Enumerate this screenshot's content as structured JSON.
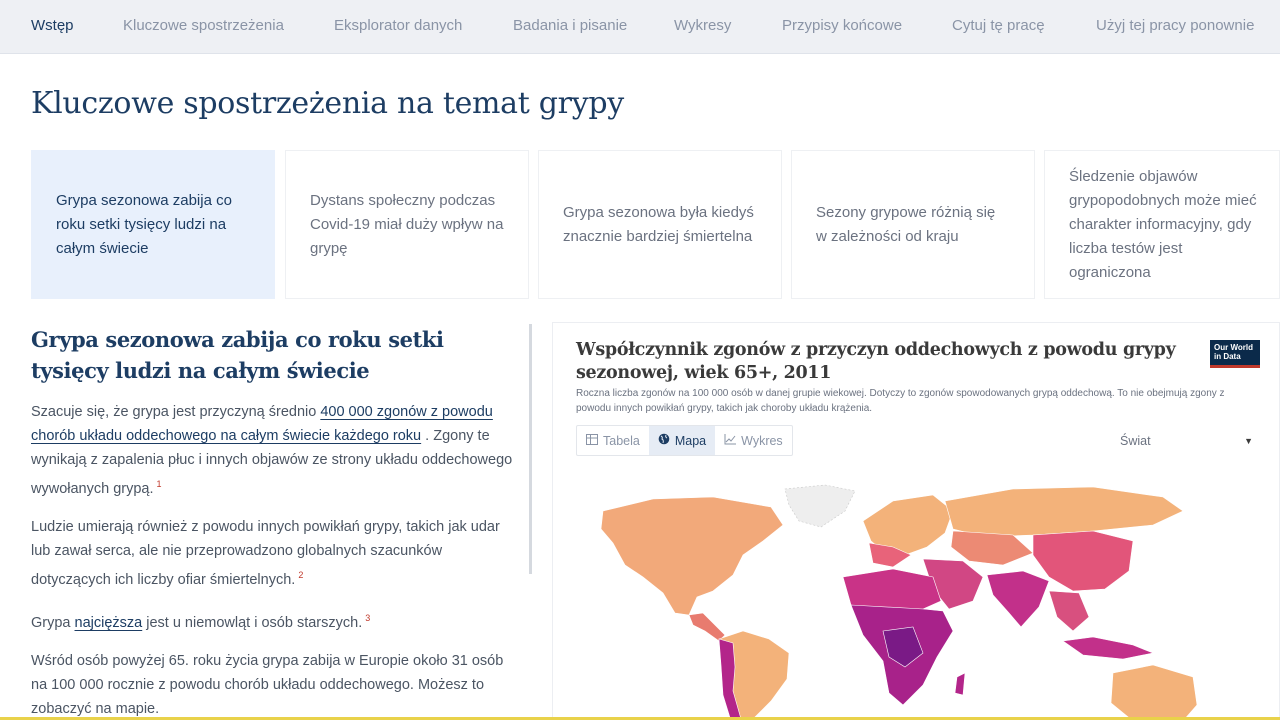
{
  "nav": {
    "items": [
      {
        "label": "Wstęp",
        "active": true
      },
      {
        "label": "Kluczowe spostrzeżenia",
        "active": false
      },
      {
        "label": "Eksplorator danych",
        "active": false
      },
      {
        "label": "Badania i pisanie",
        "active": false
      },
      {
        "label": "Wykresy",
        "active": false
      },
      {
        "label": "Przypisy końcowe",
        "active": false
      },
      {
        "label": "Cytuj tę pracę",
        "active": false
      },
      {
        "label": "Użyj tej pracy ponownie",
        "active": false
      }
    ]
  },
  "page": {
    "title": "Kluczowe spostrzeżenia na temat grypy"
  },
  "cards": [
    {
      "text": "Grypa sezonowa zabija co roku setki tysięcy ludzi na całym świecie",
      "active": true
    },
    {
      "text": "Dystans społeczny podczas Covid-19 miał duży wpływ na grypę",
      "active": false
    },
    {
      "text": "Grypa sezonowa była kiedyś znacznie bardziej śmiertelna",
      "active": false
    },
    {
      "text": "Sezony grypowe różnią się w zależności od kraju",
      "active": false
    },
    {
      "text": "Śledzenie objawów grypopodobnych może mieć charakter informacyjny, gdy liczba testów jest ograniczona",
      "active": false
    }
  ],
  "article": {
    "heading": "Grypa sezonowa zabija co roku setki tysięcy ludzi na całym świecie",
    "p1_before": "Szacuje się, że grypa jest przyczyną średnio ",
    "p1_link": "400 000 zgonów z powodu chorób układu oddechowego na całym świecie każdego roku",
    "p1_after": " . Zgony te wynikają z zapalenia płuc i innych objawów ze strony układu oddechowego wywołanych grypą.",
    "p1_ref": "1",
    "p2": "Ludzie umierają również z powodu innych powikłań grypy, takich jak udar lub zawał serca, ale nie przeprowadzono globalnych szacunków dotyczących ich liczby ofiar śmiertelnych.",
    "p2_ref": "2",
    "p3_before": "Grypa ",
    "p3_link": "najcięższa",
    "p3_after": " jest u niemowląt i osób starszych.",
    "p3_ref": "3",
    "p4": "Wśród osób powyżej 65. roku życia grypa zabija w Europie około 31 osób na 100 000 rocznie z powodu chorób układu oddechowego. Możesz to zobaczyć na mapie."
  },
  "chart": {
    "title": "Współczynnik zgonów z przyczyn oddechowych z powodu grypy sezonowej, wiek 65+, 2011",
    "subtitle": "Roczna liczba zgonów na 100 000 osób w danej grupie wiekowej. Dotyczy to zgonów spowodowanych grypą oddechową. To nie obejmują zgony z powodu innych powikłań grypy, takich jak choroby układu krążenia.",
    "logo_line1": "Our World",
    "logo_line2": "in Data",
    "tabs": [
      {
        "label": "Tabela",
        "icon": "table-icon",
        "active": false
      },
      {
        "label": "Mapa",
        "icon": "globe-icon",
        "active": true
      },
      {
        "label": "Wykres",
        "icon": "line-chart-icon",
        "active": false
      }
    ],
    "region": "Świat",
    "colors": {
      "low": "#f3b27a",
      "mid": "#e8637a",
      "high": "#b3258a",
      "highest": "#7a1a86",
      "nodata": "#e8e8e8"
    }
  }
}
